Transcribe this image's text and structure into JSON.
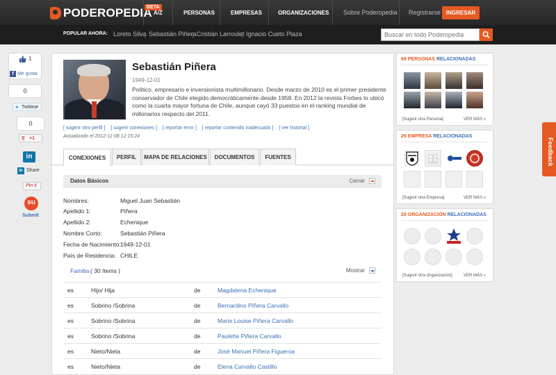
{
  "header": {
    "logo": "PODEROPEDIA",
    "beta": "BETA",
    "nav": [
      "A/Z",
      "PERSONAS",
      "EMPRESAS",
      "ORGANIZACIONES"
    ],
    "about": "Sobre Poderopedia",
    "register": "Registrarse",
    "login": "INGRESAR"
  },
  "popular": {
    "label": "POPULAR AHORA:",
    "items": [
      "Loreto Silva",
      "Sebastián Piñera",
      "Cristián Larroulet",
      "Ignacio Cueto Plaza"
    ]
  },
  "search": {
    "placeholder": "Buscar en todo Poderopedia"
  },
  "social": {
    "like_count": "1",
    "like_label": "Me gusta",
    "tweet_count": "0",
    "tweet_label": "Twittear",
    "gplus_count": "0",
    "gplus_label": "+1",
    "linkedin_share": "Share",
    "pinterest": "Pin it",
    "stumble": "Submit"
  },
  "profile": {
    "name": "Sebastián Piñera",
    "birth": "1949-12-01",
    "bio": "Político, empresario e inversionista multimillonario. Desde marzo de 2010 es el primer presidente conservador de Chile elegido democráticamente desde 1958. En 2012 la revista Forbes lo ubicó como la cuarta mayor fortuna de Chile, aunque cayó 33 puestos en el ranking mundial de millonarios respecto del 2011.",
    "edit_links": [
      "[ sugerir otro perfil ]",
      "[ sugerir conexiones ]",
      "[ reportar error ]",
      "[ reportar contenido inadecuado ]",
      "[ ver historial ]"
    ],
    "updated": "Actualizado el 2012-11-08 12:15:24"
  },
  "tabs": [
    "CONEXIONES",
    "PERFIL",
    "MAPA DE RELACIONES",
    "DOCUMENTOS",
    "FUENTES"
  ],
  "basic": {
    "title": "Datos Básicos",
    "toggle": "Cerrar",
    "fields": [
      {
        "label": "Nombres:",
        "value": "Miguel Juan Sebastián"
      },
      {
        "label": "Apellido 1:",
        "value": "Piñera"
      },
      {
        "label": "Apellido 2:",
        "value": "Echenique"
      },
      {
        "label": "Nombre Corto:",
        "value": "Sebastián Piñera"
      },
      {
        "label": "Fecha de Nacimiento:",
        "value": "1949-12-01"
      },
      {
        "label": "País de Residencia:",
        "value": "CHILE"
      }
    ]
  },
  "family": {
    "link": "Familia",
    "count": "( 30 Items )",
    "toggle": "Mostrar",
    "rows": [
      {
        "es": "es",
        "type": "Hijo/ Hija",
        "de": "de",
        "name": "Magdalena Echenique"
      },
      {
        "es": "es",
        "type": "Sobrino /Sobrina",
        "de": "de",
        "name": "Bernardino Piñera Carvallo"
      },
      {
        "es": "es",
        "type": "Sobrino /Sobrina",
        "de": "de",
        "name": "Marie Louise Piñera Carvallo"
      },
      {
        "es": "es",
        "type": "Sobrino /Sobrina",
        "de": "de",
        "name": "Paulette Piñera Carvallo"
      },
      {
        "es": "es",
        "type": "Nieto/Nieta",
        "de": "de",
        "name": "José Manuel Piñera Figueroa"
      },
      {
        "es": "es",
        "type": "Nieto/Nieta",
        "de": "de",
        "name": "Elena Carvallo Castillo"
      }
    ]
  },
  "related": {
    "people": {
      "count": "69",
      "kind": "PERSONAS",
      "suffix": "RELACIONADAS",
      "suggest": "[Sugerir otra Persona]",
      "more": "VER MÁS »"
    },
    "companies": {
      "count": "29",
      "kind": "EMPRESA",
      "suffix": "RELACIONADAS",
      "suggest": "[Sugerir otra Empresa]",
      "more": "VER MÁS »"
    },
    "orgs": {
      "count": "20",
      "kind": "ORGANIZACIÓN",
      "suffix": "RELACIONADAS",
      "suggest": "[Sugerir otra Organización]",
      "more": "VER MÁS »"
    }
  },
  "feedback": "Feedback",
  "colors": {
    "accent": "#e55a22",
    "link": "#3a6fb5",
    "topbar": "#2c2c2c"
  }
}
